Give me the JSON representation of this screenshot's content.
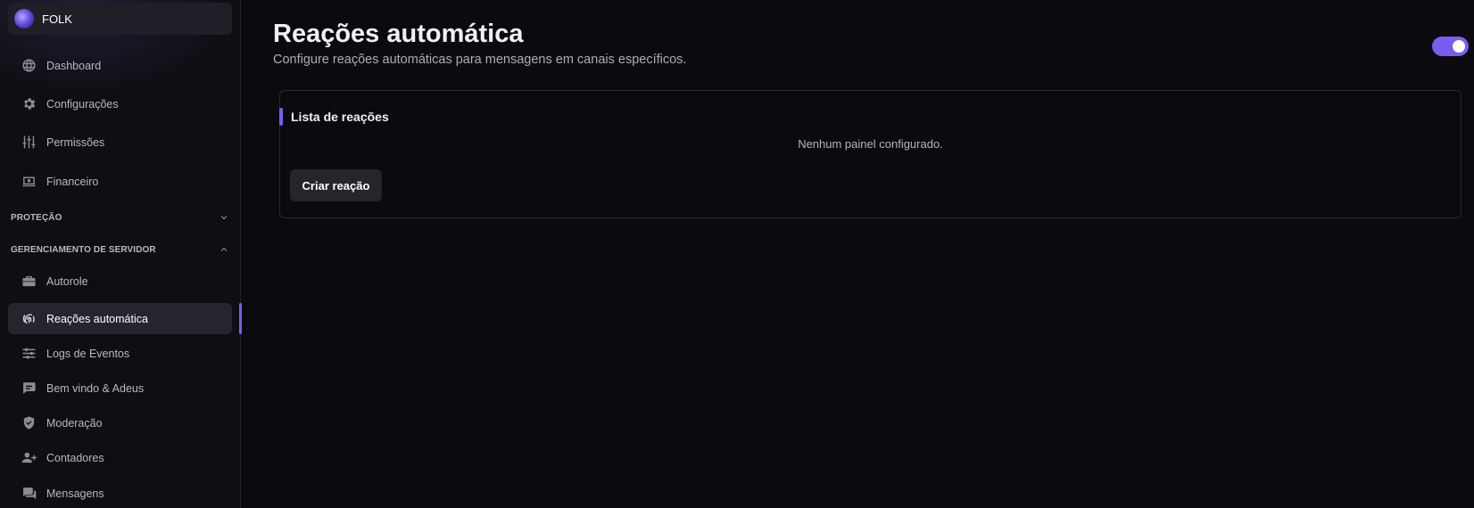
{
  "server": {
    "name": "FOLK",
    "logo_icon": "server-logo"
  },
  "sidebar": {
    "top_items": [
      {
        "label": "Dashboard",
        "icon": "globe-icon"
      },
      {
        "label": "Configurações",
        "icon": "gear-icon"
      },
      {
        "label": "Permissões",
        "icon": "sliders-icon"
      },
      {
        "label": "Financeiro",
        "icon": "money-icon"
      }
    ],
    "sections": [
      {
        "title": "PROTEÇÃO",
        "expanded": false
      },
      {
        "title": "GERENCIAMENTO DE SERVIDOR",
        "expanded": true
      }
    ],
    "server_items": [
      {
        "label": "Autorole",
        "icon": "briefcase-icon"
      },
      {
        "label": "Reações automática",
        "icon": "fingerprint-icon",
        "active": true
      },
      {
        "label": "Logs de Eventos",
        "icon": "filters-icon"
      },
      {
        "label": "Bem vindo & Adeus",
        "icon": "chat-icon"
      },
      {
        "label": "Moderação",
        "icon": "shield-icon"
      },
      {
        "label": "Contadores",
        "icon": "user-plus-icon"
      },
      {
        "label": "Mensagens",
        "icon": "messages-icon"
      }
    ]
  },
  "main": {
    "title": "Reações automática",
    "subtitle": "Configure reações automáticas para mensagens em canais específicos.",
    "toggle_on": true,
    "card": {
      "title": "Lista de reações",
      "empty_text": "Nenhum painel configurado.",
      "button_label": "Criar reação"
    }
  },
  "colors": {
    "accent": "#7b5cf0",
    "background": "#0b0a0e",
    "sidebar": "#0f0e12"
  }
}
